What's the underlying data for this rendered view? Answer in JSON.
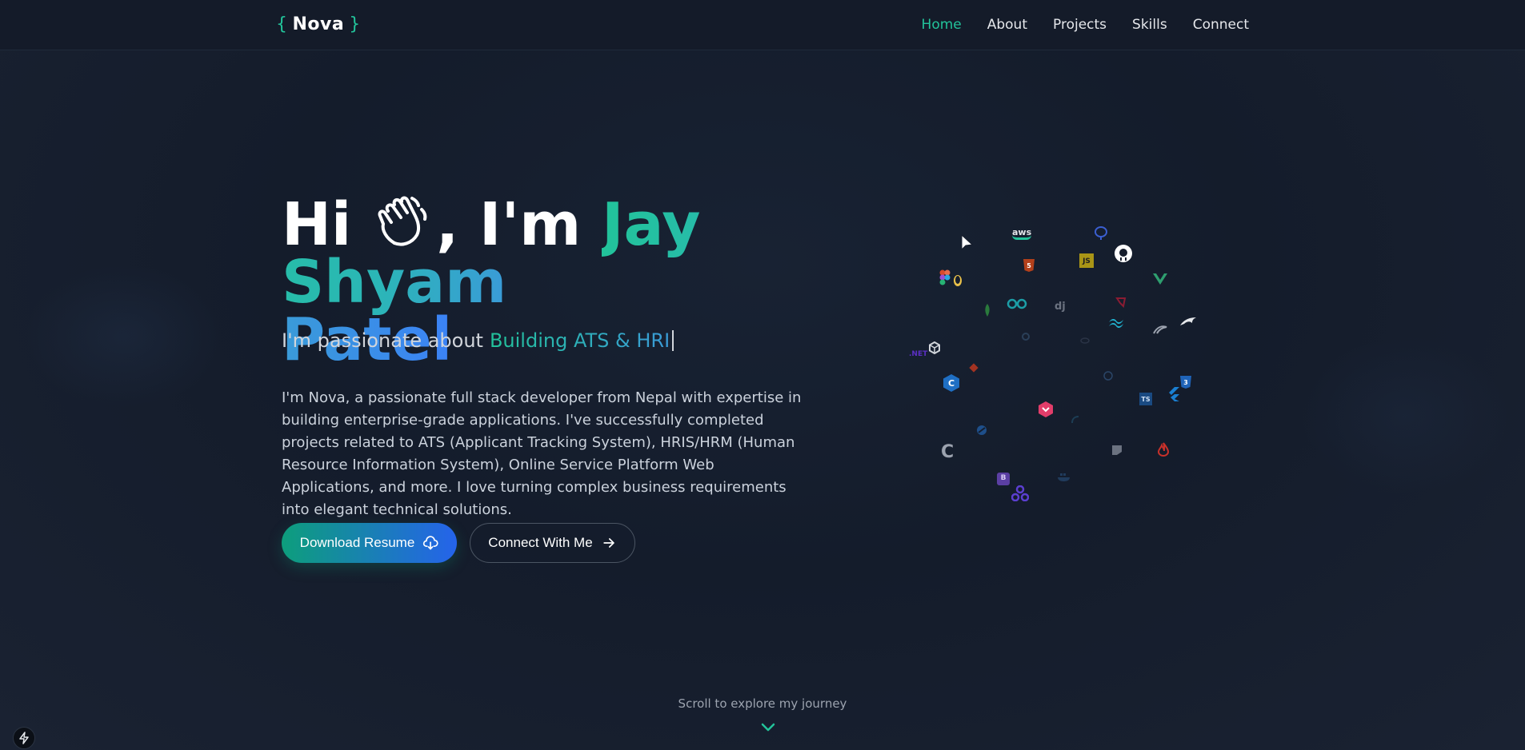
{
  "nav": {
    "logo_open": "{",
    "logo_name": "Nova",
    "logo_close": "}",
    "links": [
      "Home",
      "About",
      "Projects",
      "Skills",
      "Connect"
    ],
    "active": "Home"
  },
  "hero": {
    "greeting_hi": "Hi",
    "greeting_im": ", I'm",
    "name_part1": "Jay Shyam",
    "name_part2": "Patel",
    "tagline_prefix": "I'm passionate about",
    "tagline_typed": "Building ATS & HRI",
    "bio": "I'm Nova, a passionate full stack developer from Nepal with expertise in building enterprise-grade applications. I've successfully completed projects related to ATS (Applicant Tracking System), HRIS/HRM (Human Resource Information System), Online Service Platform Web Applications, and more. I love turning complex business requirements into elegant technical solutions.",
    "primary_button": "Download Resume",
    "secondary_button": "Connect With Me"
  },
  "skill_cloud": {
    "icons": [
      "aws",
      "postgresql",
      "github",
      "html5",
      "javascript",
      "vue",
      "figma",
      "linux",
      "mongodb",
      "arduino",
      "django",
      "nestjs",
      "tailwind",
      "mysql",
      "dotnet",
      "unity",
      "git",
      "csharp",
      "css3",
      "flutter",
      "graphql",
      "typescript",
      "c",
      "express",
      "firebase",
      "bootstrap",
      "docker",
      "redux"
    ],
    "labels": {
      "aws": "aws",
      "javascript": "JS",
      "django": "dj",
      "dotnet": ".NET",
      "typescript": "TS",
      "c": "C"
    }
  },
  "footer": {
    "scroll_text": "Scroll to explore my journey"
  },
  "colors": {
    "accent": "#22c39a",
    "blue": "#3b82f6",
    "background": "#151d2c"
  }
}
